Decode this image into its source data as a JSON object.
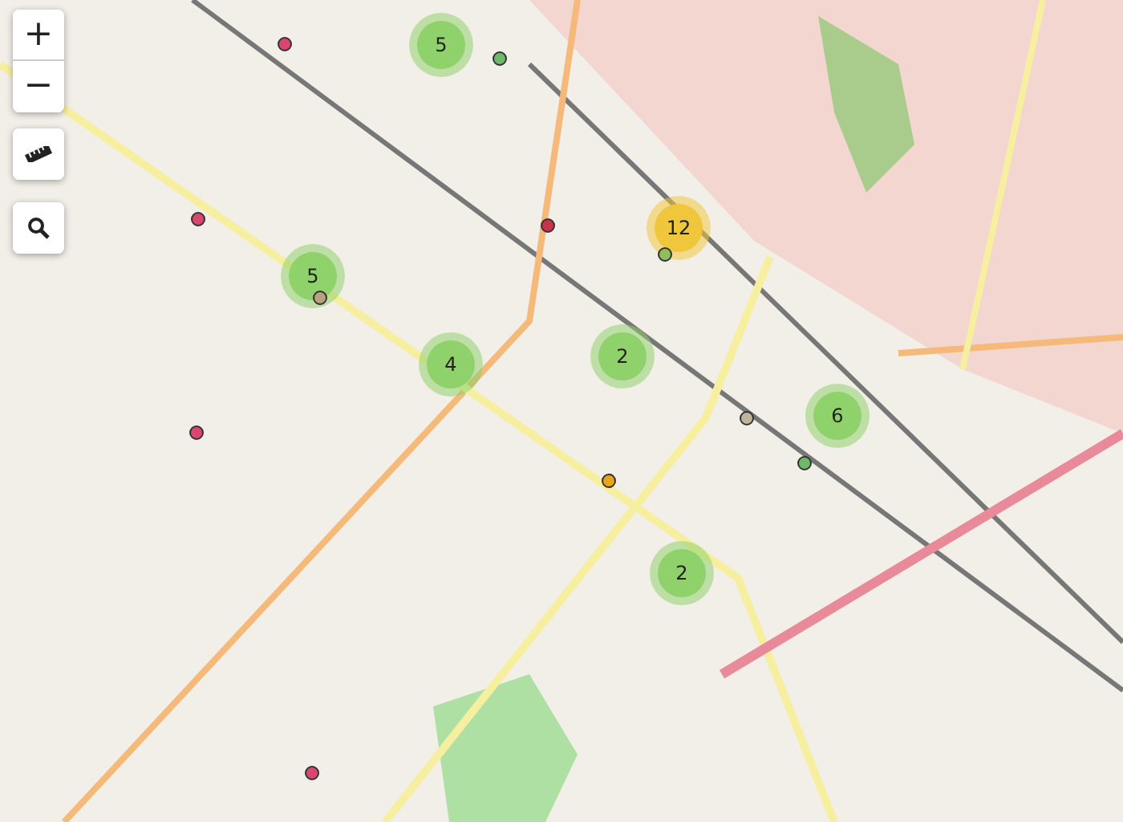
{
  "zoom_control": {
    "zoom_in": "+",
    "zoom_out": "−"
  },
  "clusters": [
    {
      "count": "5",
      "color": "#8fd16a"
    },
    {
      "count": "5",
      "color": "#8fd16a"
    },
    {
      "count": "4",
      "color": "#8fd16a"
    },
    {
      "count": "12",
      "color": "#f0c63c"
    },
    {
      "count": "2",
      "color": "#8fd16a"
    },
    {
      "count": "6",
      "color": "#8fd16a"
    },
    {
      "count": "2",
      "color": "#8fd16a"
    }
  ],
  "markers": [
    {
      "color": "#d9476f"
    },
    {
      "color": "#6fb86a"
    },
    {
      "color": "#d9476f"
    },
    {
      "color": "#c8334a"
    },
    {
      "color": "#8fbf5a"
    },
    {
      "color": "#b8a27e"
    },
    {
      "color": "#d9476f"
    },
    {
      "color": "#c2b49a"
    },
    {
      "color": "#6fb86a"
    },
    {
      "color": "#e8a321"
    },
    {
      "color": "#d9476f"
    }
  ]
}
